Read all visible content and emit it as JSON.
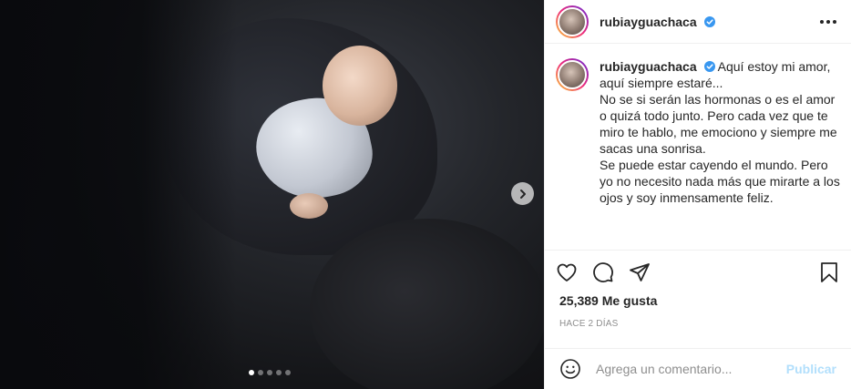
{
  "post": {
    "username": "rubiayguachaca",
    "verified": true,
    "carousel": {
      "total": 5,
      "active_index": 0
    },
    "caption": {
      "username": "rubiayguachaca",
      "lines": [
        "Aquí estoy mi amor, aquí siempre estaré...",
        "No se si serán las hormonas o es el amor o quizá todo junto. Pero cada vez que te miro te hablo, me emociono y siempre me sacas una sonrisa.",
        "Se puede estar cayendo el mundo. Pero yo no necesito nada más que mirarte a los ojos y soy inmensamente feliz."
      ]
    },
    "likes_text": "25,389 Me gusta",
    "time_text": "HACE 2 DÍAS",
    "comment": {
      "placeholder": "Agrega un comentario...",
      "value": "",
      "publish_label": "Publicar"
    },
    "colors": {
      "verified": "#3897f0",
      "publish": "#b2dffc",
      "border": "#efefef",
      "muted": "#8e8e8e"
    },
    "icons": [
      "chevron-right-icon",
      "more-icon",
      "heart-icon",
      "comment-icon",
      "share-icon",
      "bookmark-icon",
      "emoji-icon",
      "verified-badge-icon"
    ]
  }
}
